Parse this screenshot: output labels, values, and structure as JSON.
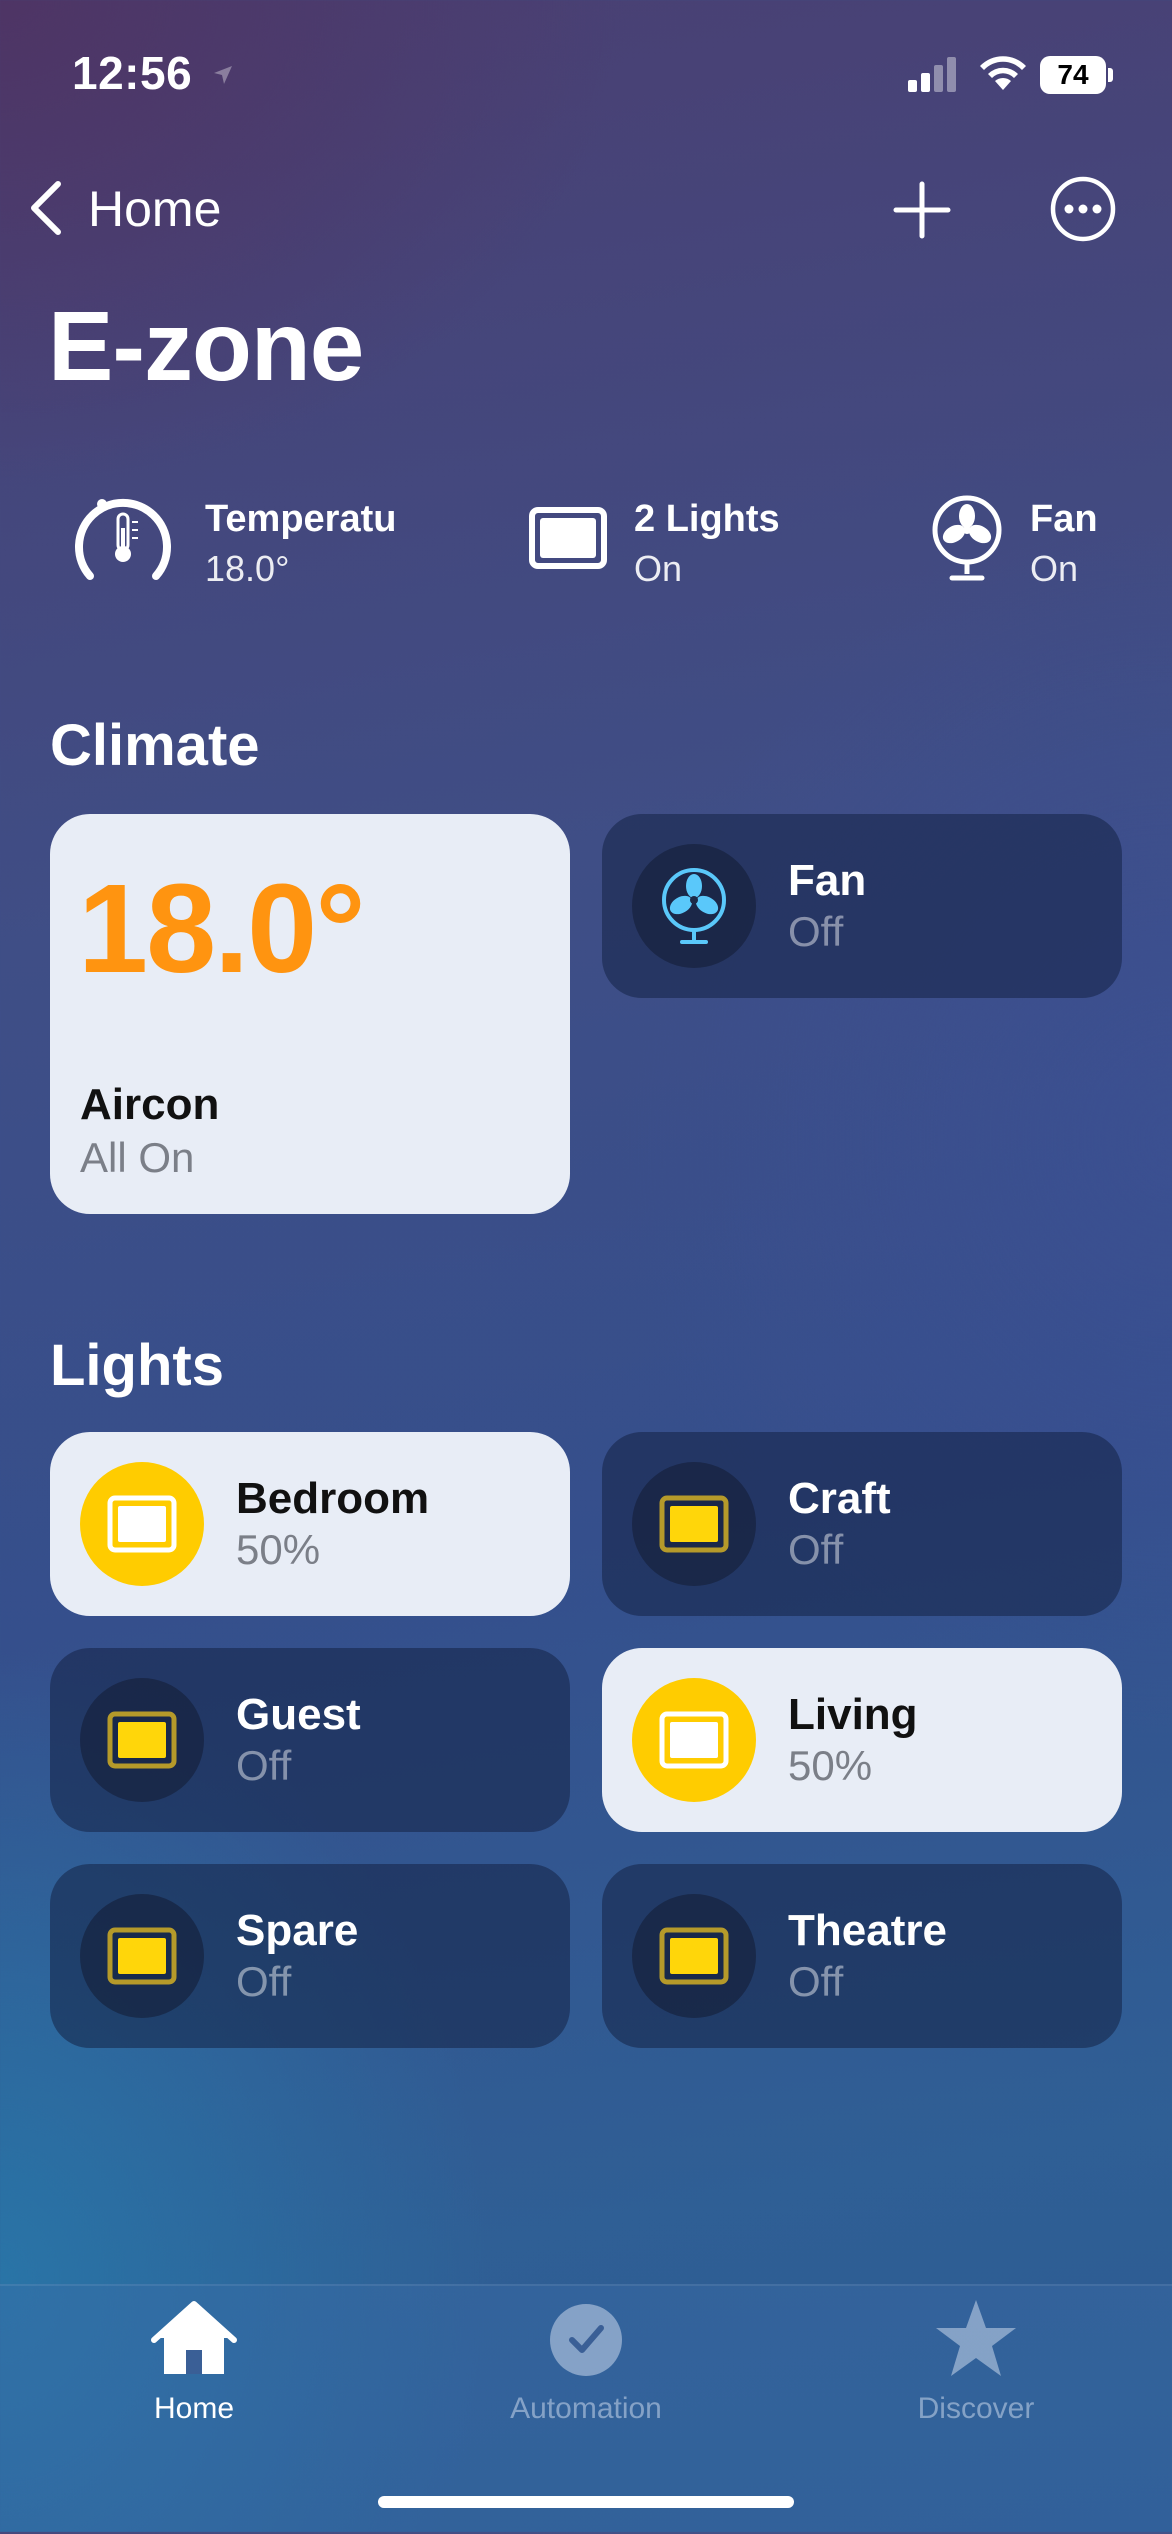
{
  "status_bar": {
    "time": "12:56",
    "battery": "74"
  },
  "nav": {
    "back_label": "Home"
  },
  "page_title": "E-zone",
  "summary": [
    {
      "title": "Temperatu",
      "subtitle": "18.0°",
      "icon": "thermometer-gauge-icon"
    },
    {
      "title": "2 Lights",
      "subtitle": "On",
      "icon": "light-panel-icon"
    },
    {
      "title": "Fan",
      "subtitle": "On",
      "icon": "fan-icon"
    }
  ],
  "climate": {
    "title": "Climate",
    "aircon": {
      "temp": "18.0°",
      "name": "Aircon",
      "state": "All On"
    },
    "fan": {
      "name": "Fan",
      "state": "Off"
    }
  },
  "lights": {
    "title": "Lights",
    "items": [
      {
        "name": "Bedroom",
        "state": "50%",
        "on": true
      },
      {
        "name": "Craft",
        "state": "Off",
        "on": false
      },
      {
        "name": "Guest",
        "state": "Off",
        "on": false
      },
      {
        "name": "Living",
        "state": "50%",
        "on": true
      },
      {
        "name": "Spare",
        "state": "Off",
        "on": false
      },
      {
        "name": "Theatre",
        "state": "Off",
        "on": false
      }
    ]
  },
  "tabs": [
    {
      "label": "Home",
      "icon": "house-icon",
      "active": true
    },
    {
      "label": "Automation",
      "icon": "clock-check-icon",
      "active": false
    },
    {
      "label": "Discover",
      "icon": "star-icon",
      "active": false
    }
  ],
  "colors": {
    "accent_orange": "#ff9410",
    "light_on": "#ffcc00",
    "light_off_panel": "#ffd60a"
  }
}
